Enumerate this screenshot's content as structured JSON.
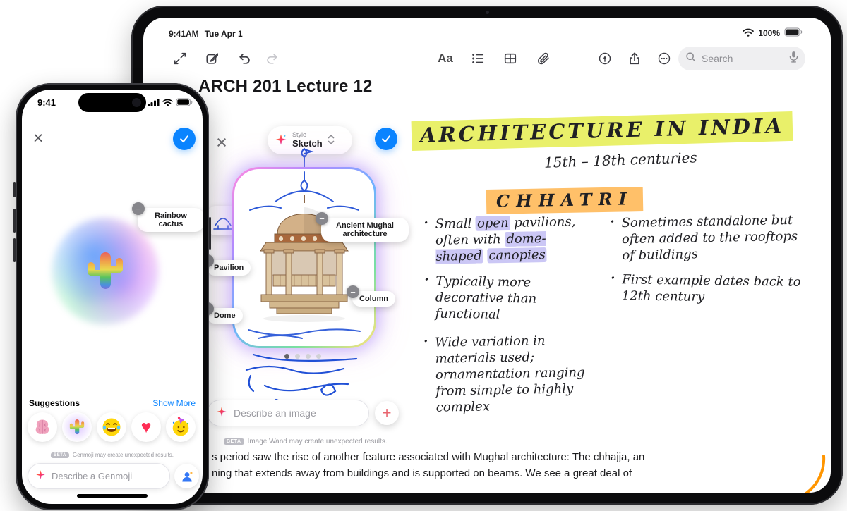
{
  "icons": {
    "close": "×",
    "remove": "−",
    "add": "+"
  },
  "colors": {
    "accent_blue": "#0a84ff",
    "highlight_yellow": "#e9f06a",
    "highlight_orange": "#ffc069",
    "highlight_purple": "#cbc7f5",
    "ink_blue": "#2150d6"
  },
  "phone": {
    "status_bar": {
      "time": "9:41"
    },
    "genmoji_sheet": {
      "tag_label": "Rainbow cactus",
      "suggestions_label": "Suggestions",
      "show_more_label": "Show More",
      "suggestion_icons": [
        "brain-emoji",
        "rainbow-cactus-emoji",
        "laughing-crying-emoji",
        "red-heart-emoji",
        "party-face-emoji"
      ],
      "beta_badge": "BETA",
      "beta_note": "Genmoji may create unexpected results.",
      "input_placeholder": "Describe a Genmoji"
    }
  },
  "tablet": {
    "status_bar": {
      "time": "9:41AM",
      "date": "Tue Apr 1",
      "battery_percent": "100%"
    },
    "toolbar": {
      "format_label": "Aa",
      "search_placeholder": "Search"
    },
    "note": {
      "title": "ARCH 201 Lecture 12",
      "body_lines": [
        "s period saw the rise of another feature associated with Mughal architecture: The chhajja, an",
        "ning that extends away from buildings and is supported on beams. We see a great deal of"
      ]
    },
    "image_wand": {
      "style_label": "Style",
      "style_value": "Sketch",
      "tags": [
        "Ancient Mughal architecture",
        "Pavilion",
        "Dome",
        "Column"
      ],
      "input_placeholder": "Describe an image",
      "beta_badge": "BETA",
      "beta_note": "Image Wand may create unexpected results."
    },
    "handwriting": {
      "heading": "ARCHITECTURE IN INDIA",
      "subheading": "15th – 18th centuries",
      "topic": "CHHATRI",
      "columns": [
        {
          "bullets": [
            {
              "segments": [
                {
                  "t": "Small "
                },
                {
                  "t": "open",
                  "hl": true
                },
                {
                  "t": " pavilions, often with "
                },
                {
                  "t": "dome-shaped",
                  "hl": true
                },
                {
                  "t": " "
                },
                {
                  "t": "canopies",
                  "hl": true
                }
              ]
            },
            {
              "segments": [
                {
                  "t": "Typically more decorative than functional"
                }
              ]
            },
            {
              "segments": [
                {
                  "t": "Wide variation in materials used; ornamentation ranging from simple to highly complex"
                }
              ]
            }
          ]
        },
        {
          "bullets": [
            {
              "segments": [
                {
                  "t": "Sometimes standalone but often added to the rooftops of buildings"
                }
              ]
            },
            {
              "segments": [
                {
                  "t": "First example dates back to 12th century"
                }
              ]
            }
          ]
        }
      ]
    }
  }
}
